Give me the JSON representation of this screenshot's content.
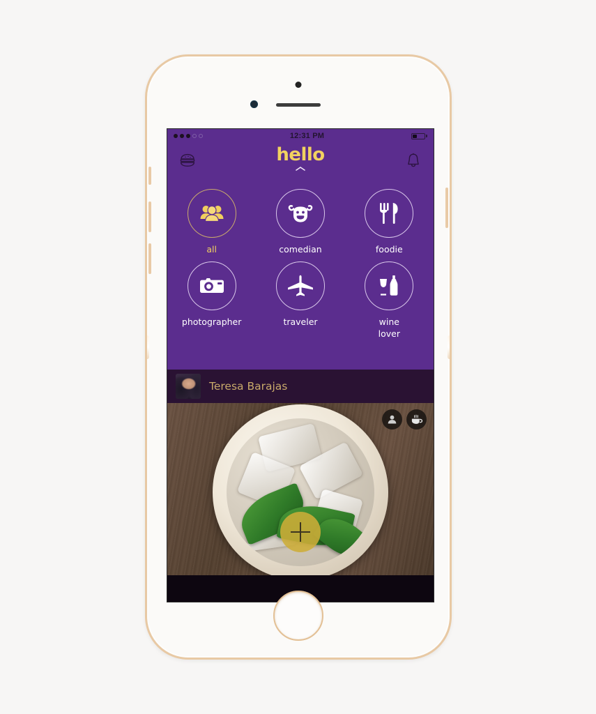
{
  "device": {
    "name": "iphone-gold",
    "hardware": {
      "earpiece": "earpiece-speaker",
      "front_camera": "front-camera",
      "sensor": "proximity-sensor",
      "home_button": "home-button"
    }
  },
  "status_bar": {
    "time": "12:31 PM",
    "signal_dots_filled": 3,
    "signal_dots_total": 5,
    "battery_percent": 40,
    "battery_icon": "battery-icon"
  },
  "header": {
    "menu_icon": "hamburger-burger-icon",
    "logo_text": "hello",
    "chevron_icon": "chevron-up-icon",
    "notification_icon": "bell-icon"
  },
  "categories": {
    "active": "all",
    "rows": [
      [
        {
          "id": "all",
          "label": "all",
          "icon": "group-people-icon",
          "active": true
        },
        {
          "id": "comedian",
          "label": "comedian",
          "icon": "cow-face-icon",
          "active": false
        },
        {
          "id": "foodie",
          "label": "foodie",
          "icon": "fork-knife-icon",
          "active": false
        }
      ],
      [
        {
          "id": "photographer",
          "label": "photographer",
          "icon": "camera-icon",
          "active": false
        },
        {
          "id": "traveler",
          "label": "traveler",
          "icon": "airplane-icon",
          "active": false
        },
        {
          "id": "wine-lover",
          "label": "wine\nlover",
          "label_line1": "wine",
          "label_line2": "lover",
          "icon": "wine-glass-bottle-icon",
          "active": false
        }
      ]
    ]
  },
  "post": {
    "author": "Teresa Barajas",
    "avatar_icon": "user-avatar-photo",
    "photo_alt": "iced creamy drink with mint leaves on wooden table",
    "badges": [
      {
        "id": "person",
        "icon": "person-icon"
      },
      {
        "id": "coffee",
        "icon": "coffee-cup-icon"
      }
    ],
    "fab": {
      "icon": "plus-icon",
      "label": "+"
    }
  },
  "colors": {
    "purple": "#5b2d8e",
    "dark_purple": "#2a1233",
    "gold": "#f2d260",
    "gold_muted": "#c8a96a",
    "fab_gold": "#cdad38",
    "white": "#ffffff",
    "phone_bezel": "#e8c9a4",
    "page_background": "#f7f6f5"
  }
}
